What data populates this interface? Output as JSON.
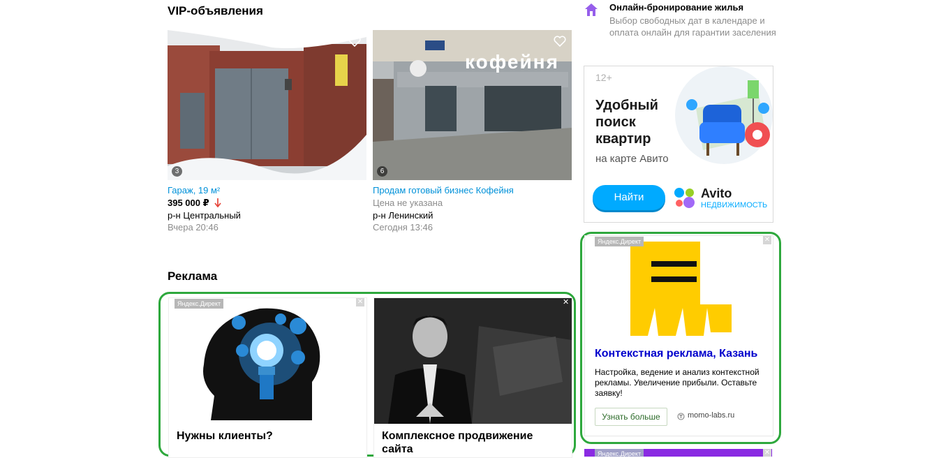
{
  "vip": {
    "heading": "VIP-объявления",
    "cards": [
      {
        "photo_count": "3",
        "title": "Гараж, 19 м²",
        "price": "395 000 ₽",
        "price_trend": "down",
        "district": "р-н Центральный",
        "date": "Вчера 20:46"
      },
      {
        "photo_count": "6",
        "title": "Продам готовый бизнес Кофейня",
        "price": "Цена не указана",
        "district": "р-н Ленинский",
        "date": "Сегодня 13:46",
        "sign_text": "кофейня"
      }
    ]
  },
  "ads_section": {
    "heading": "Реклама",
    "label": "Яндекс.Директ",
    "items": [
      {
        "caption": "Нужны клиенты?"
      },
      {
        "caption": "Комплексное продвижение сайта"
      }
    ]
  },
  "sidebar": {
    "booking": {
      "title": "Онлайн-бронирование жилья",
      "text": "Выбор свободных дат в календаре и оплата онлайн для гарантии заселения"
    },
    "avito_banner": {
      "age": "12+",
      "headline": "Удобный поиск квартир",
      "sub": "на карте Авито",
      "button": "Найти",
      "brand": "Avito",
      "brand_sub": "НЕДВИЖИМОСТЬ"
    },
    "direct_ad": {
      "label": "Яндекс.Директ",
      "title": "Контекстная реклама, Казань",
      "text": "Настройка, ведение и анализ контекстной рекламы. Увеличение прибыли. Оставьте заявку!",
      "button": "Узнать больше",
      "domain": "momo-labs.ru"
    },
    "bottom_label": "Яндекс.Директ"
  },
  "colors": {
    "link": "#0091d9",
    "highlight": "#2ea83d",
    "ad_title": "#0000cc",
    "avito_blue": "#00aaff",
    "yellow": "#ffcc00"
  },
  "icons": {
    "favorite": "heart-icon",
    "booking": "house-icon",
    "close": "close-icon",
    "price_down": "arrow-down-icon",
    "domain": "favicon-icon"
  }
}
